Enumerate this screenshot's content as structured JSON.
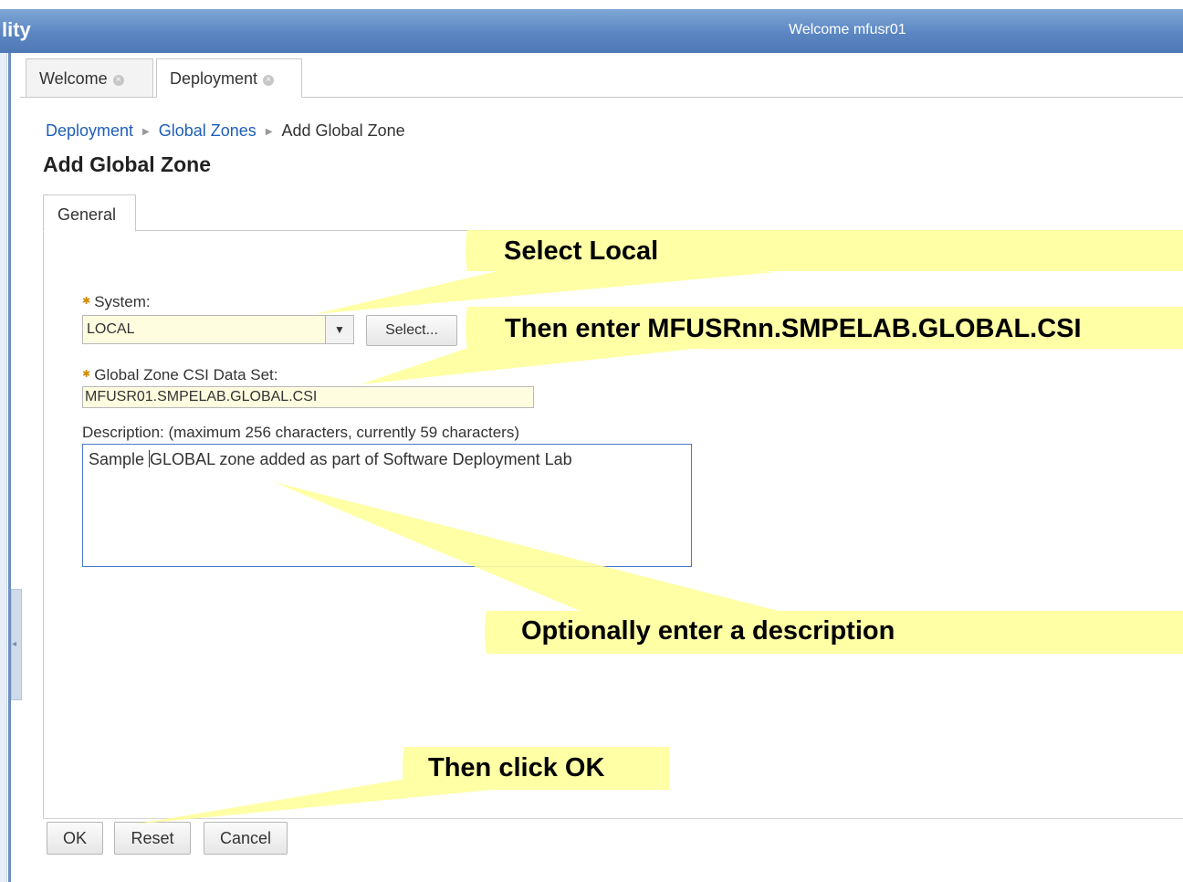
{
  "header": {
    "app_title": "lity",
    "welcome": "Welcome mfusr01"
  },
  "tabs": [
    {
      "label": "Welcome"
    },
    {
      "label": "Deployment"
    }
  ],
  "breadcrumb": {
    "items": [
      "Deployment",
      "Global Zones",
      "Add Global Zone"
    ]
  },
  "page_title": "Add Global Zone",
  "subtab": "General",
  "form": {
    "system_label": "System:",
    "system_value": "LOCAL",
    "select_button": "Select...",
    "csi_label": "Global Zone CSI Data Set:",
    "csi_value": "MFUSR01.SMPELAB.GLOBAL.CSI",
    "description_label": "Description: (maximum 256 characters, currently 59 characters)",
    "description_value_before_caret": "Sample ",
    "description_value_after_caret": "GLOBAL zone added as part of Software Deployment Lab"
  },
  "buttons": {
    "ok": "OK",
    "reset": "Reset",
    "cancel": "Cancel"
  },
  "callouts": {
    "select_local": "Select Local",
    "enter_csi": "Then enter MFUSRnn.SMPELAB.GLOBAL.CSI",
    "enter_description": "Optionally enter a description",
    "click_ok": "Then click OK",
    "fill_color": "#FFFF99"
  }
}
